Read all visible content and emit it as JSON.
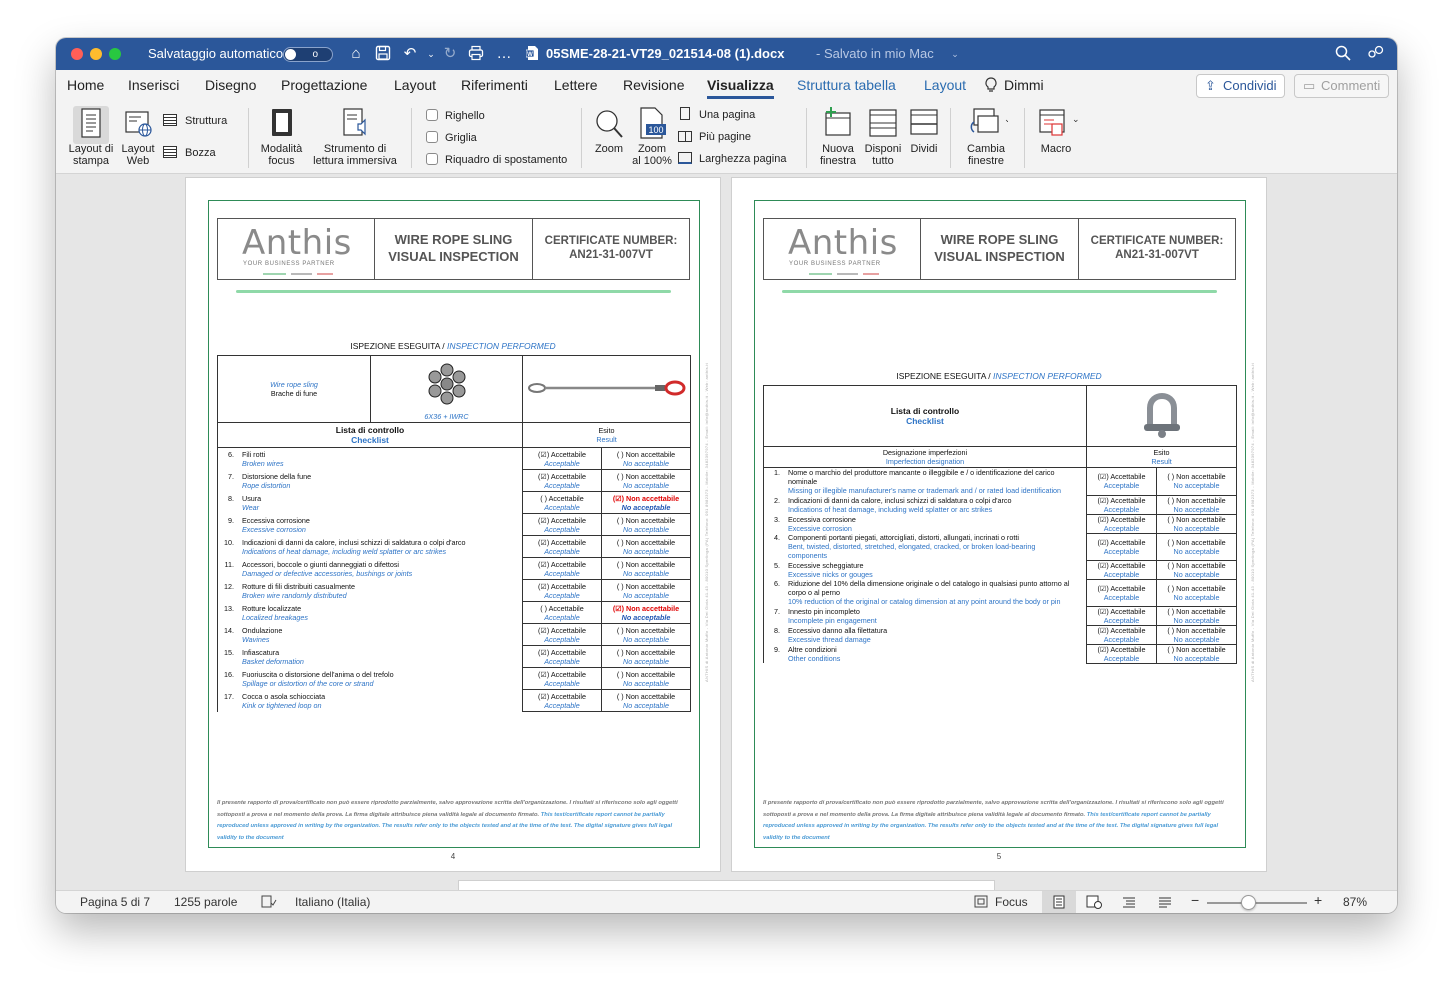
{
  "titlebar": {
    "autosave_label": "Salvataggio automatico",
    "autosave_state": "o",
    "doc_title": "05SME-28-21-VT29_021514-08 (1).docx",
    "save_status": "- Salvato in mio Mac",
    "more": "…"
  },
  "menu": {
    "items": [
      "Home",
      "Inserisci",
      "Disegno",
      "Progettazione",
      "Layout",
      "Riferimenti",
      "Lettere",
      "Revisione",
      "Visualizza",
      "Struttura tabella",
      "Layout",
      "Dimmi"
    ],
    "share_label": "Condividi",
    "comments_label": "Commenti"
  },
  "ribbon": {
    "print_layout": [
      "Layout di",
      "stampa"
    ],
    "web_layout": [
      "Layout",
      "Web"
    ],
    "outline": "Struttura",
    "draft": "Bozza",
    "focus": [
      "Modalità",
      "focus"
    ],
    "immersive": [
      "Strumento di",
      "lettura immersiva"
    ],
    "ruler": "Righello",
    "grid": "Griglia",
    "nav_pane": "Riquadro di spostamento",
    "zoom": "Zoom",
    "zoom100": [
      "Zoom",
      "al 100%"
    ],
    "zoom100_badge": "100",
    "one_page": "Una pagina",
    "multi_pages": "Più pagine",
    "page_width": "Larghezza pagina",
    "new_window": [
      "Nuova",
      "finestra"
    ],
    "arrange": [
      "Disponi",
      "tutto"
    ],
    "split": "Dividi",
    "switch": [
      "Cambia",
      "finestre"
    ],
    "macro": "Macro"
  },
  "doc": {
    "logo_text": "Anthis",
    "logo_sub": "YOUR BUSINESS PARTNER",
    "title_l1": "WIRE ROPE SLING",
    "title_l2": "VISUAL INSPECTION",
    "cert_l1": "CERTIFICATE NUMBER:",
    "cert_l2": "AN21-31-007VT",
    "inspection_it": "ISPEZIONE ESEGUITA /",
    "inspection_en": "INSPECTION PERFORMED",
    "footer_it": "Il presente rapporto di prova/certificato non può essere riprodotto parzialmente, salvo approvazione scritta dell'organizzazione. I risultati si riferiscono solo agli oggetti sottoposti a prova e nel momento della prova. La firma digitale attribuisce piena validità legale al documento firmato.",
    "footer_en": "This test/certificate report cannot be partially reproduced unless approved in writing by the organization. The results refer only to the objects tested and at the time of the test. The digital signature gives full legal validity to the document",
    "side_text": "ANTHIS di Antonio Muffo - Via Dei Gioia 41-43 - 80010 Sperlinga (PA) Telefono: 091 8982373 - Mobile: 3482397974 - Email: info@anthis.it - Web: anthis.it",
    "acc_it": "Accettabile",
    "acc_en": "Acceptable",
    "nacc_it": "Non accettabile",
    "nacc_en": "No acceptable",
    "box_checked": "(☑)",
    "box_empty": "( )",
    "page4": {
      "number": "4",
      "sling_en": "Wire rope sling",
      "sling_it": "Brache di fune",
      "construction": "6X36 + IWRC",
      "list_it": "Lista di controllo",
      "list_en": "Checklist",
      "result_it": "Esito",
      "result_en": "Result",
      "rows": [
        {
          "n": "6.",
          "it": "Fili rotti",
          "en": "Broken wires",
          "ok": true
        },
        {
          "n": "7.",
          "it": "Distorsione della fune",
          "en": "Rope distortion",
          "ok": true
        },
        {
          "n": "8.",
          "it": "Usura",
          "en": "Wear",
          "ok": false
        },
        {
          "n": "9.",
          "it": "Eccessiva corrosione",
          "en": "Excessive corrosion",
          "ok": true
        },
        {
          "n": "10.",
          "it": "Indicazioni di danni da calore, inclusi schizzi di saldatura o colpi d'arco",
          "en": "Indications of heat damage, including weld splatter or arc strikes",
          "ok": true
        },
        {
          "n": "11.",
          "it": "Accessori, boccole o giunti danneggiati o difettosi",
          "en": "Damaged or defective accessories, bushings or joints",
          "ok": true
        },
        {
          "n": "12.",
          "it": "Rotture di fili distribuiti casualmente",
          "en": "Broken wire randomly distributed",
          "ok": true
        },
        {
          "n": "13.",
          "it": "Rotture localizzate",
          "en": "Localized breakages",
          "ok": false
        },
        {
          "n": "14.",
          "it": "Ondulazione",
          "en": "Wavines",
          "ok": true
        },
        {
          "n": "15.",
          "it": "Infiascatura",
          "en": "Basket deformation",
          "ok": true
        },
        {
          "n": "16.",
          "it": "Fuoriuscita o distorsione dell'anima o del trefolo",
          "en": "Spillage or distortion of the core or strand",
          "ok": true
        },
        {
          "n": "17.",
          "it": "Cocca o asola schiocciata",
          "en": "Kink or tightened loop on",
          "ok": true
        }
      ]
    },
    "page5": {
      "number": "5",
      "list_it": "Lista di controllo",
      "list_en": "Checklist",
      "desig_it": "Designazione imperfezioni",
      "desig_en": "Imperfection designation",
      "result_it": "Esito",
      "result_en": "Result",
      "rows": [
        {
          "n": "1.",
          "it": "Nome o marchio del produttore mancante o illeggibile e / o identificazione del carico nominale",
          "en": "Missing or illegible manufacturer's name or trademark and / or rated load identification",
          "ok": true
        },
        {
          "n": "2.",
          "it": "Indicazioni di danni da calore, inclusi schizzi di saldatura o colpi d'arco",
          "en": "Indications of heat damage, including weld splatter or arc strikes",
          "ok": true
        },
        {
          "n": "3.",
          "it": "Eccessiva corrosione",
          "en": "Excessive corrosion",
          "ok": true
        },
        {
          "n": "4.",
          "it": "Componenti portanti piegati, attorcigliati, distorti, allungati, incrinati o rotti",
          "en": "Bent, twisted, distorted, stretched, elongated, cracked, or broken load-bearing components",
          "ok": true
        },
        {
          "n": "5.",
          "it": "Eccessive scheggiature",
          "en": "Excessive nicks or gouges",
          "ok": true
        },
        {
          "n": "6.",
          "it": "Riduzione del 10% della dimensione originale o del catalogo in qualsiasi punto attorno al corpo o al perno",
          "en": "10% reduction of the original or catalog dimension at any point around the body or pin",
          "ok": true
        },
        {
          "n": "7.",
          "it": "Innesto pin incompleto",
          "en": "Incomplete pin engagement",
          "ok": true
        },
        {
          "n": "8.",
          "it": "Eccessivo danno alla filettatura",
          "en": "Excessive thread damage",
          "ok": true
        },
        {
          "n": "9.",
          "it": "Altre condizioni",
          "en": "Other conditions",
          "ok": true
        }
      ]
    }
  },
  "status": {
    "page": "Pagina 5 di 7",
    "words": "1255 parole",
    "language": "Italiano (Italia)",
    "focus": "Focus",
    "zoom": "87%",
    "zoom_value_percent": 87
  }
}
